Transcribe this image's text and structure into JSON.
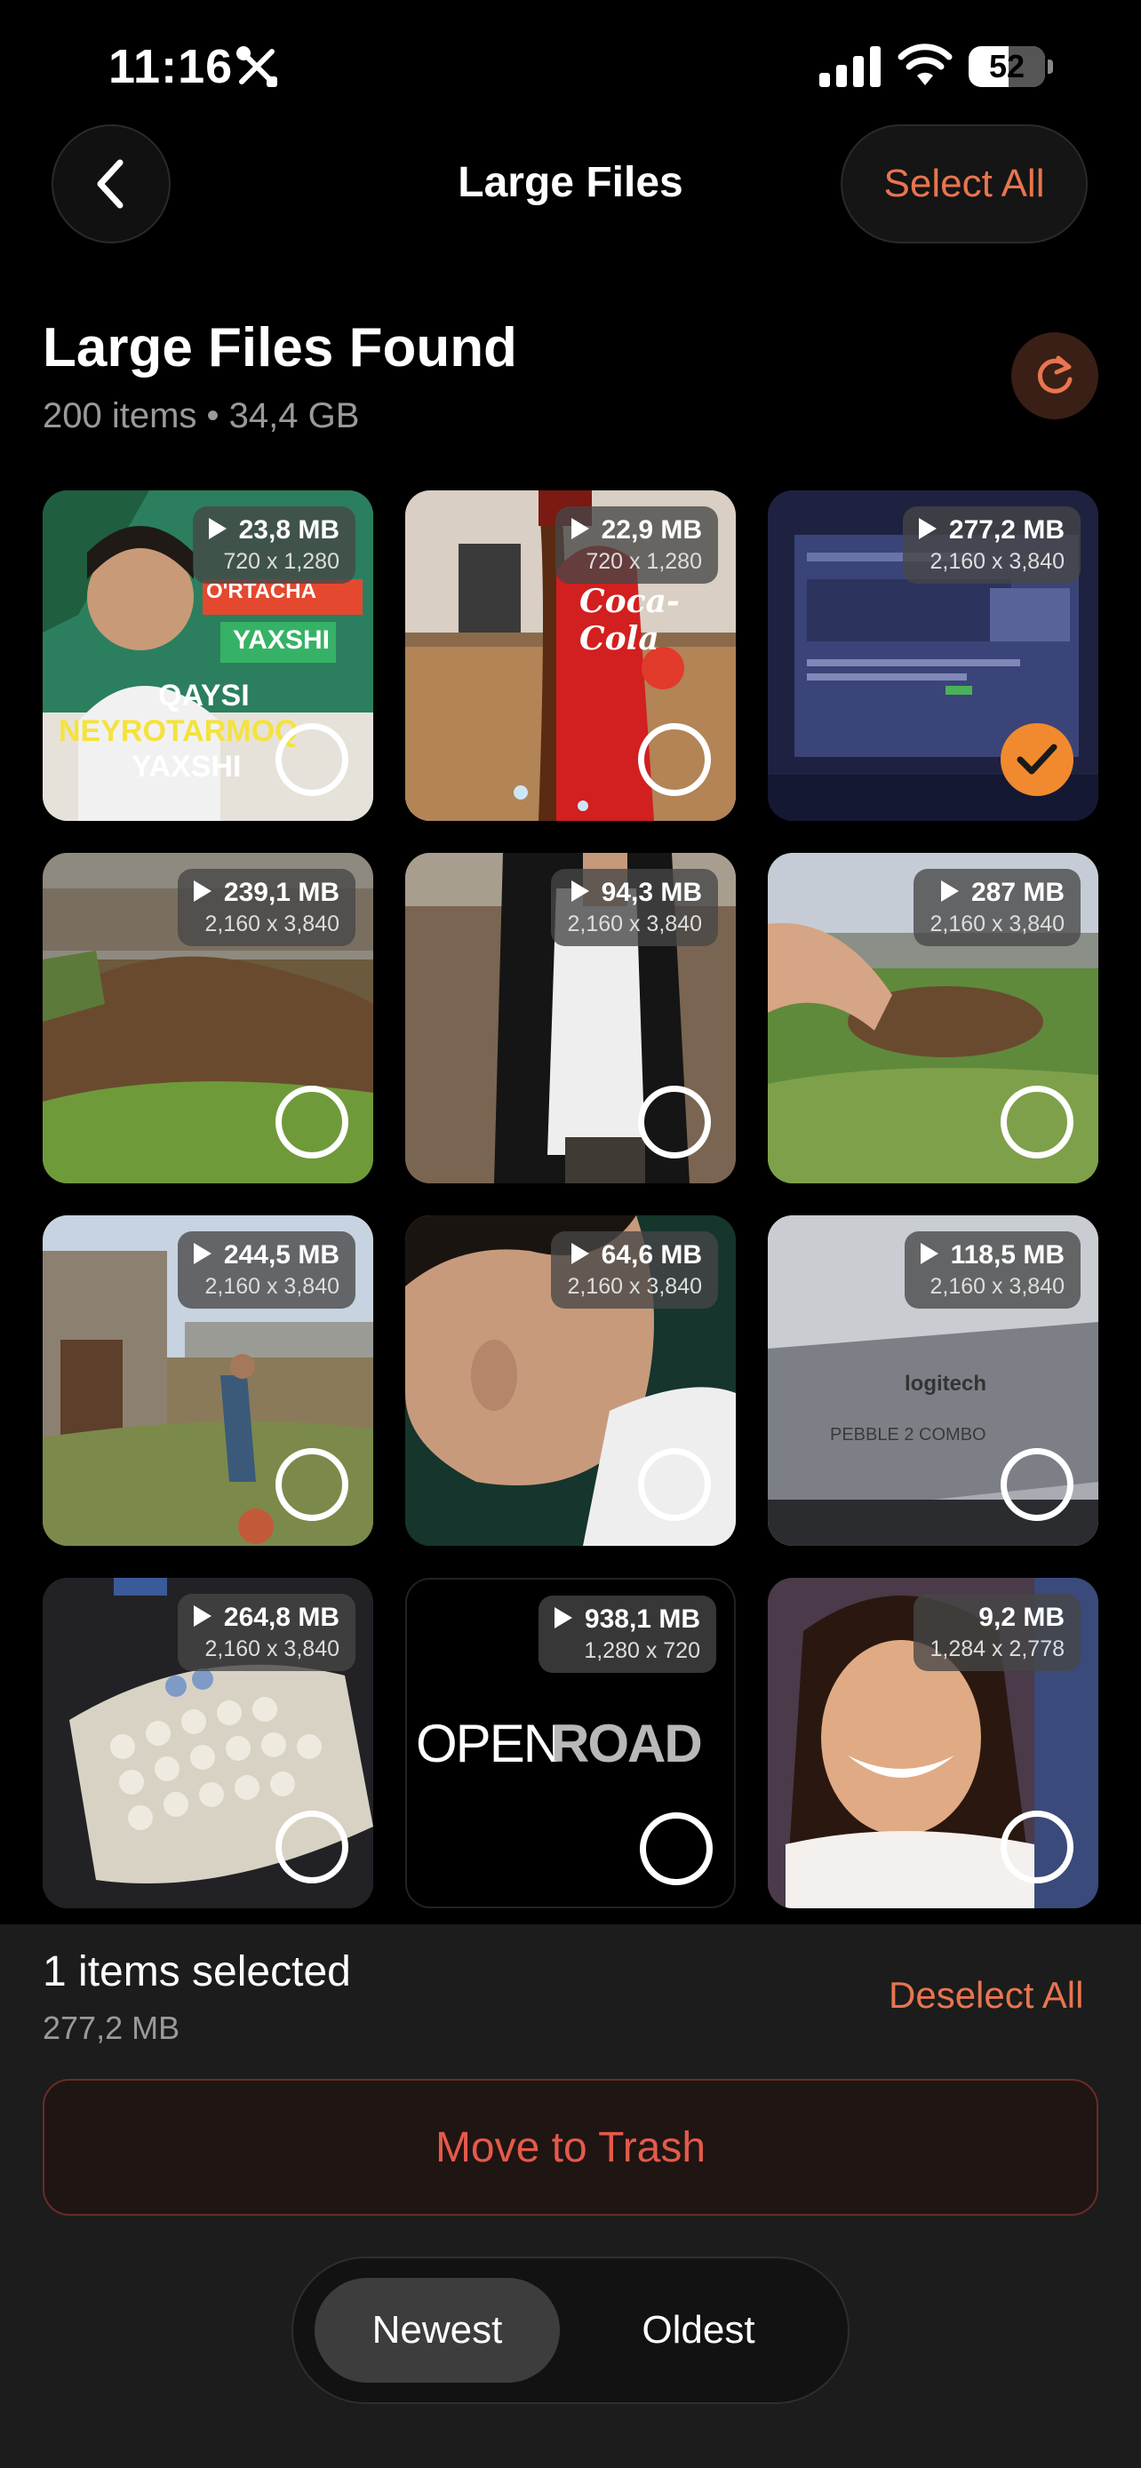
{
  "status_bar": {
    "time": "11:16",
    "battery_percent": "52",
    "battery_level": 0.52
  },
  "nav": {
    "title": "Large Files",
    "select_all_label": "Select All"
  },
  "header": {
    "title": "Large Files Found",
    "subtitle": "200 items • 34,4 GB"
  },
  "files": [
    {
      "size": "23,8 MB",
      "resolution": "720 x 1,280",
      "selected": false,
      "thumb_texts": [
        "O'RTACHA",
        "YAXSHI",
        "QAYSI",
        "NEYROTARMOQ",
        "YAXSHI"
      ]
    },
    {
      "size": "22,9 MB",
      "resolution": "720 x 1,280",
      "selected": false,
      "thumb_texts": [
        "Coca-Cola"
      ]
    },
    {
      "size": "277,2 MB",
      "resolution": "2,160 x 3,840",
      "selected": true
    },
    {
      "size": "239,1 MB",
      "resolution": "2,160 x 3,840",
      "selected": false
    },
    {
      "size": "94,3 MB",
      "resolution": "2,160 x 3,840",
      "selected": false
    },
    {
      "size": "287 MB",
      "resolution": "2,160 x 3,840",
      "selected": false
    },
    {
      "size": "244,5 MB",
      "resolution": "2,160 x 3,840",
      "selected": false
    },
    {
      "size": "64,6 MB",
      "resolution": "2,160 x 3,840",
      "selected": false
    },
    {
      "size": "118,5 MB",
      "resolution": "2,160 x 3,840",
      "selected": false,
      "thumb_texts": [
        "logitech",
        "PEBBLE 2 COMBO"
      ]
    },
    {
      "size": "264,8 MB",
      "resolution": "2,160 x 3,840",
      "selected": false
    },
    {
      "size": "938,1 MB",
      "resolution": "1,280 x 720",
      "selected": false,
      "thumb_texts": [
        "OPEN",
        "ROAD"
      ]
    },
    {
      "size": "9,2 MB",
      "resolution": "1,284 x 2,778",
      "selected": false
    }
  ],
  "selection": {
    "count_label": "1 items selected",
    "size_label": "277,2 MB",
    "deselect_all_label": "Deselect All"
  },
  "actions": {
    "move_to_trash_label": "Move to Trash"
  },
  "sort": {
    "newest_label": "Newest",
    "oldest_label": "Oldest",
    "active": "Newest"
  },
  "colors": {
    "accent": "#e8754f",
    "danger": "#e45a4a",
    "check": "#f18a2e"
  }
}
